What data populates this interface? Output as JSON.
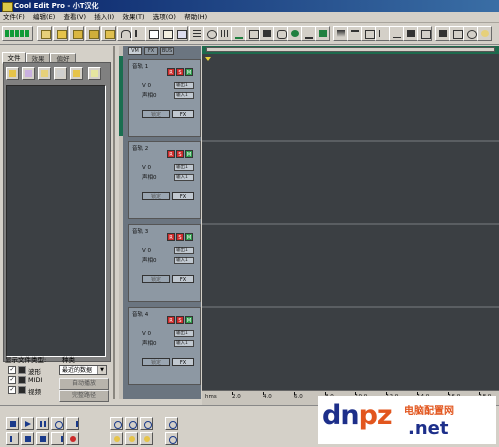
{
  "window": {
    "title": "Cool Edit Pro  - 小T汉化"
  },
  "menu": [
    "文件(F)",
    "编辑(E)",
    "查看(V)",
    "插入(I)",
    "效果(T)",
    "选项(O)",
    "帮助(H)"
  ],
  "left_panel": {
    "tabs": [
      "文件",
      "效果",
      "偏好"
    ],
    "show_file_types_label": "显示文件类型:",
    "sort_label": "种类",
    "file_types": [
      {
        "label": "波形",
        "checked": true
      },
      {
        "label": "MIDI",
        "checked": true
      },
      {
        "label": "视频",
        "checked": true
      }
    ],
    "sort_value": "最近的数据",
    "button_1": "自动播放",
    "button_2": "完整路径"
  },
  "track_tabs": [
    "VM",
    "FX",
    "BUS"
  ],
  "tracks": [
    {
      "name": "音轨 1",
      "volume": "V 0",
      "pan": "声相0",
      "out": "输出1",
      "in": "输入1"
    },
    {
      "name": "音轨 2",
      "volume": "V 0",
      "pan": "声相0",
      "out": "输出1",
      "in": "输入1"
    },
    {
      "name": "音轨 3",
      "volume": "V 0",
      "pan": "声相0",
      "out": "输出1",
      "in": "输入1"
    },
    {
      "name": "音轨 4",
      "volume": "V 0",
      "pan": "声相0",
      "out": "输出1",
      "in": "输入1"
    }
  ],
  "track_buttons": {
    "r": "R",
    "s": "S",
    "m": "M",
    "lock": "锁定",
    "fx": "FX"
  },
  "time_ruler": {
    "unit": "hms",
    "ticks": [
      "2.0",
      "4.0",
      "6.0",
      "8.0",
      "10.0",
      "12.0",
      "14.0",
      "16.0",
      "18.0"
    ]
  },
  "watermark": {
    "logo_a": "dn",
    "logo_b": "pz",
    "site_name": "电脑配置网",
    "url": ".net"
  },
  "colors": {
    "accent_green": "#1d6a4d",
    "record_red": "#cc2a2a",
    "solo_green": "#2d9a4a"
  }
}
